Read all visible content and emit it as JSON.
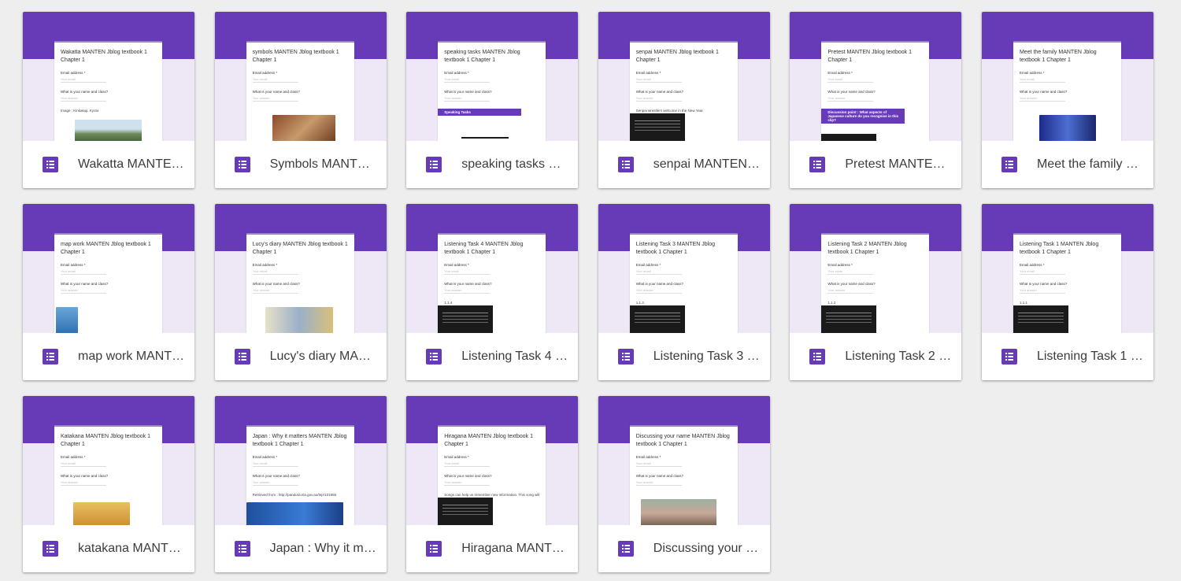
{
  "colors": {
    "brand": "#673ab7",
    "brand_light": "#ede7f6",
    "background": "#eeeeee"
  },
  "preview_text": {
    "email_label": "Email address *",
    "email_placeholder": "Your email",
    "question": "What is your name and class?",
    "answer_placeholder": "Your answer"
  },
  "forms": [
    {
      "title": "Wakatta MANTEN Jblog textbook 1 Chapter 1",
      "preview_title": "Wakatta MANTEN Jblog textbook 1 Chapter 1",
      "note": "Image : Kinkakuji, Kyoto",
      "media": "photo-green"
    },
    {
      "title": "Symbols MANTEN Jblog textbook 1 Chapter 1",
      "preview_title": "symbols MANTEN Jblog textbook 1 Chapter 1",
      "note": "",
      "media": "photo-brown"
    },
    {
      "title": "speaking tasks MANTEN Jblog textbook 1 Chapter 1",
      "preview_title": "speaking tasks MANTEN Jblog textbook 1 Chapter 1",
      "note": "Speaking Tasks",
      "media": "band"
    },
    {
      "title": "senpai MANTEN Jblog textbook 1 Chapter 1",
      "preview_title": "senpai MANTEN Jblog textbook 1 Chapter 1",
      "note": "Senpai wrestlers welcome in the New Year",
      "media": "video"
    },
    {
      "title": "Pretest MANTEN Jblog textbook 1 Chapter 1",
      "preview_title": "Pretest MANTEN Jblog textbook 1 Chapter 1",
      "note": "Discussion point : What aspects of Japanese culture do you recognise in this clip?",
      "media": "band-video"
    },
    {
      "title": "Meet the family MANTEN Jblog textbook 1 Chapter 1",
      "preview_title": "Meet the family MANTEN Jblog textbook 1 Chapter 1",
      "note": "",
      "media": "photo-blue"
    },
    {
      "title": "map work MANTEN Jblog textbook 1 Chapter 1",
      "preview_title": "map work MANTEN Jblog textbook 1 Chapter 1",
      "note": "",
      "media": "photo-map"
    },
    {
      "title": "Lucy's diary MANTEN Jblog textbook 1 Chapter 1",
      "preview_title": "Lucy's diary MANTEN Jblog textbook 1 Chapter 1",
      "note": "",
      "media": "photo-comic"
    },
    {
      "title": "Listening Task 4 MANTEN Jblog textbook 1 Chapter 1",
      "preview_title": "Listening Task 4 MANTEN Jblog textbook 1 Chapter 1",
      "note": "1.1.4",
      "media": "video"
    },
    {
      "title": "Listening Task 3 MANTEN Jblog textbook 1 Chapter 1",
      "preview_title": "Listening Task 3 MANTEN Jblog textbook 1 Chapter 1",
      "note": "1.1.3",
      "media": "video"
    },
    {
      "title": "Listening Task 2 MANTEN Jblog textbook 1 Chapter 1",
      "preview_title": "Listening Task 2 MANTEN Jblog textbook 1 Chapter 1",
      "note": "1.1.2",
      "media": "video"
    },
    {
      "title": "Listening Task 1 MANTEN Jblog textbook 1 Chapter 1",
      "preview_title": "Listening Task 1 MANTEN Jblog textbook 1 Chapter 1",
      "note": "1.1.1",
      "media": "video"
    },
    {
      "title": "katakana MANTEN Jblog textbook 1 Chapter 1",
      "preview_title": "Katakana MANTEN Jblog textbook 1 Chapter 1",
      "note": "",
      "media": "photo-food"
    },
    {
      "title": "Japan : Why it matters MANTEN Jblog textbook 1 Chapter 1",
      "preview_title": "Japan : Why it matters MANTEN Jblog textbook 1 Chapter 1",
      "note": "Retrieved from : http://pandora.nla.gov.au/tep/101666",
      "media": "photo-japan"
    },
    {
      "title": "Hiragana MANTEN Jblog textbook 1 Chapter 1",
      "preview_title": "Hiragana MANTEN Jblog textbook 1 Chapter 1",
      "note": "Songs can help us remember new information. This song will teach you the basic hiragana.",
      "media": "video"
    },
    {
      "title": "Discussing your name MANTEN Jblog textbook 1 Chapter 1",
      "preview_title": "Discussing your name MANTEN Jblog textbook 1 Chapter 1",
      "note": "",
      "media": "photo-people"
    }
  ]
}
